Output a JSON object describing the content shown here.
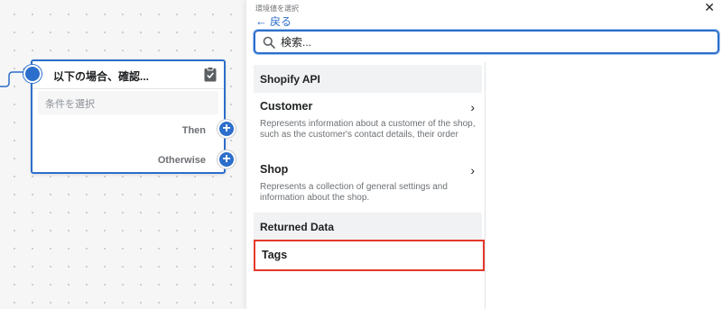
{
  "workflow": {
    "node_title": "以下の場合、確認...",
    "condition_placeholder": "条件を選択",
    "branch_then": "Then",
    "branch_otherwise": "Otherwise",
    "plus_glyph": "+",
    "accent_color": "#2c6ecb"
  },
  "panel": {
    "label": "環境値を選択",
    "close_glyph": "✕",
    "back_arrow": "←",
    "back_label": "戻る",
    "search_placeholder": "検索...",
    "sections": [
      {
        "header": "Shopify API",
        "items": [
          {
            "title": "Customer",
            "description": "Represents information about a customer of the shop, such as the customer's contact details, their order",
            "chevron": "›"
          },
          {
            "title": "Shop",
            "description": "Represents a collection of general settings and information about the shop.",
            "chevron": "›"
          }
        ]
      },
      {
        "header": "Returned Data",
        "items": [
          {
            "title": "Tags",
            "highlight_color": "#e5382a"
          }
        ]
      }
    ]
  },
  "icons": [
    "clipboard-check-icon",
    "search-icon",
    "close-icon",
    "back-arrow-icon",
    "chevron-right-icon",
    "plus-icon"
  ]
}
